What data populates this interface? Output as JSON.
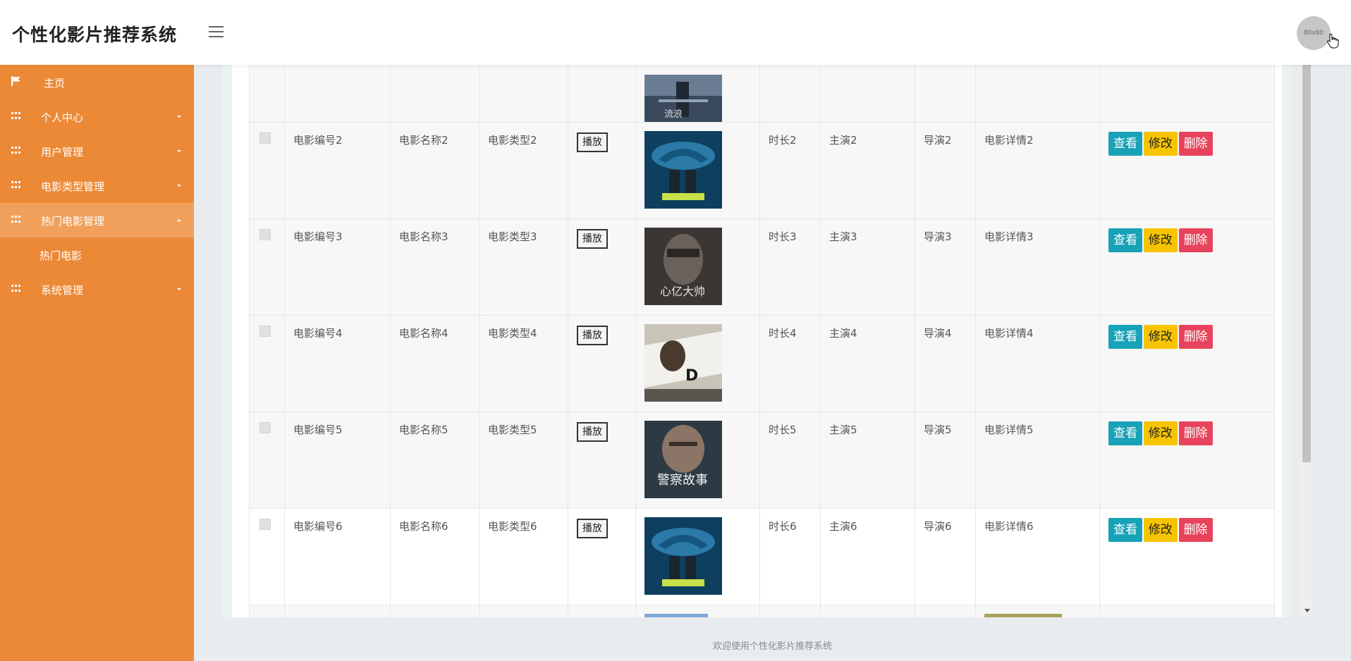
{
  "header": {
    "brand": "个性化影片推荐系统",
    "avatar_text": "80x80"
  },
  "sidebar": {
    "items": [
      {
        "label": "主页",
        "icon": "flag-icon"
      },
      {
        "label": "个人中心",
        "icon": "grid-icon"
      },
      {
        "label": "用户管理",
        "icon": "grid-icon"
      },
      {
        "label": "电影类型管理",
        "icon": "grid-icon"
      },
      {
        "label": "热门电影管理",
        "icon": "grid-icon"
      },
      {
        "label": "热门电影"
      },
      {
        "label": "系统管理",
        "icon": "grid-icon"
      }
    ]
  },
  "table": {
    "play_label": "播放",
    "view_label": "查看",
    "edit_label": "修改",
    "delete_label": "删除",
    "rows": [
      {
        "id": "电影编号2",
        "name": "电影名称2",
        "type": "电影类型2",
        "duration": "时长2",
        "actor": "主演2",
        "director": "导演2",
        "detail": "电影详情2"
      },
      {
        "id": "电影编号3",
        "name": "电影名称3",
        "type": "电影类型3",
        "duration": "时长3",
        "actor": "主演3",
        "director": "导演3",
        "detail": "电影详情3"
      },
      {
        "id": "电影编号4",
        "name": "电影名称4",
        "type": "电影类型4",
        "duration": "时长4",
        "actor": "主演4",
        "director": "导演4",
        "detail": "电影详情4"
      },
      {
        "id": "电影编号5",
        "name": "电影名称5",
        "type": "电影类型5",
        "duration": "时长5",
        "actor": "主演5",
        "director": "导演5",
        "detail": "电影详情5"
      },
      {
        "id": "电影编号6",
        "name": "电影名称6",
        "type": "电影类型6",
        "duration": "时长6",
        "actor": "主演6",
        "director": "导演6",
        "detail": "电影详情6"
      }
    ]
  },
  "footer": {
    "text": "欢迎使用个性化影片推荐系统"
  },
  "colors": {
    "sidebar": "#ec8937",
    "view_button": "#17a2b8",
    "edit_button": "#f7c400",
    "delete_button": "#e8435c"
  }
}
